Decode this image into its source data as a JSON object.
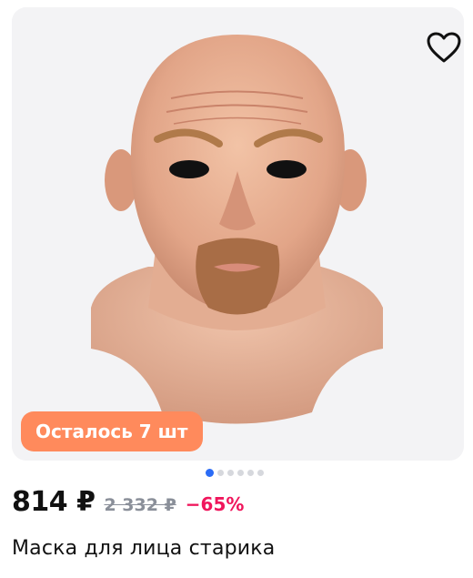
{
  "product": {
    "stock_badge": "Осталось 7 шт",
    "price": "814 ₽",
    "old_price": "2 332 ₽",
    "discount": "−65%",
    "title": "Маска для лица старика"
  },
  "gallery": {
    "total_images": 6,
    "active_index": 0
  },
  "icons": {
    "favorite": "heart-outline-icon"
  },
  "colors": {
    "badge_bg": "#ff8a5c",
    "discount": "#f0165c",
    "dot_active": "#2b6cf6",
    "dot_inactive": "#d6d8dd"
  }
}
